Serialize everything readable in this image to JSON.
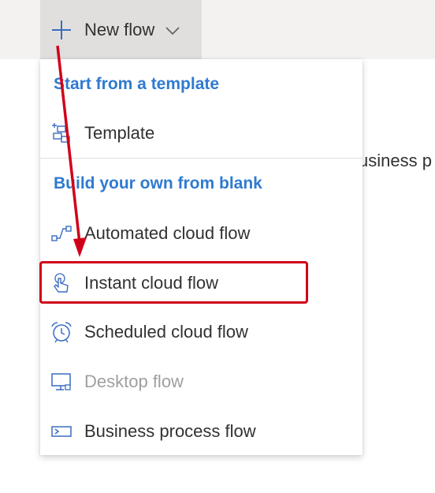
{
  "toolbar": {
    "new_flow_label": "New flow"
  },
  "background": {
    "partial_text": "usiness p"
  },
  "menu": {
    "section_template_title": "Start from a template",
    "section_blank_title": "Build your own from blank",
    "items": [
      {
        "label": "Template",
        "icon": "template-icon",
        "enabled": true
      },
      {
        "label": "Automated cloud flow",
        "icon": "automated-flow-icon",
        "enabled": true
      },
      {
        "label": "Instant cloud flow",
        "icon": "touch-icon",
        "enabled": true
      },
      {
        "label": "Scheduled cloud flow",
        "icon": "alarm-clock-icon",
        "enabled": true
      },
      {
        "label": "Desktop flow",
        "icon": "desktop-icon",
        "enabled": false
      },
      {
        "label": "Business process flow",
        "icon": "business-process-icon",
        "enabled": true
      }
    ]
  },
  "annotation": {
    "highlighted_item": "Instant cloud flow",
    "color": "#d0021b"
  },
  "colors": {
    "accent": "#2f7ad0",
    "topbar": "#f3f2f1",
    "button_bg": "#e1dfdd",
    "disabled_text": "#a19f9d"
  }
}
